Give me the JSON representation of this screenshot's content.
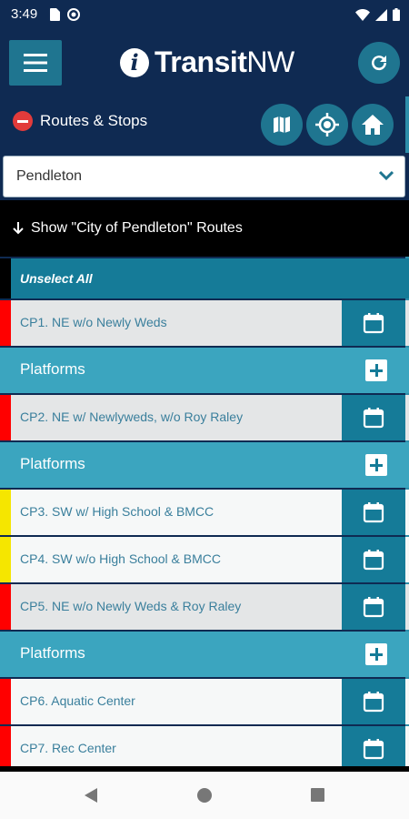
{
  "status_bar": {
    "time": "3:49"
  },
  "header": {
    "logo_letter": "i",
    "logo_bold": "Transit",
    "logo_light": "NW"
  },
  "section": {
    "title": "Routes & Stops"
  },
  "search": {
    "value": "Pendleton"
  },
  "show_routes": {
    "label": "Show \"City of Pendleton\" Routes"
  },
  "unselect": {
    "label": "Unselect All"
  },
  "colors": {
    "navy": "#0f2a52",
    "teal": "#157b98",
    "platform": "#3ba5bf",
    "route_red": "#ff0000",
    "route_yellow": "#f5e600"
  },
  "rows": [
    {
      "kind": "route",
      "label": "CP1. NE w/o Newly Weds",
      "color": "#ff0000",
      "shade": "gray"
    },
    {
      "kind": "platforms",
      "label": "Platforms"
    },
    {
      "kind": "route",
      "label": "CP2. NE w/ Newlyweds, w/o Roy Raley",
      "color": "#ff0000",
      "shade": "gray"
    },
    {
      "kind": "platforms",
      "label": "Platforms"
    },
    {
      "kind": "route",
      "label": "CP3. SW w/ High School & BMCC",
      "color": "#f5e600",
      "shade": "light"
    },
    {
      "kind": "route",
      "label": "CP4. SW w/o High School & BMCC",
      "color": "#f5e600",
      "shade": "light"
    },
    {
      "kind": "route",
      "label": "CP5. NE w/o Newly Weds & Roy Raley",
      "color": "#ff0000",
      "shade": "gray"
    },
    {
      "kind": "platforms",
      "label": "Platforms"
    },
    {
      "kind": "route",
      "label": "CP6. Aquatic Center",
      "color": "#ff0000",
      "shade": "light"
    },
    {
      "kind": "route",
      "label": "CP7. Rec Center",
      "color": "#ff0000",
      "shade": "light"
    }
  ]
}
